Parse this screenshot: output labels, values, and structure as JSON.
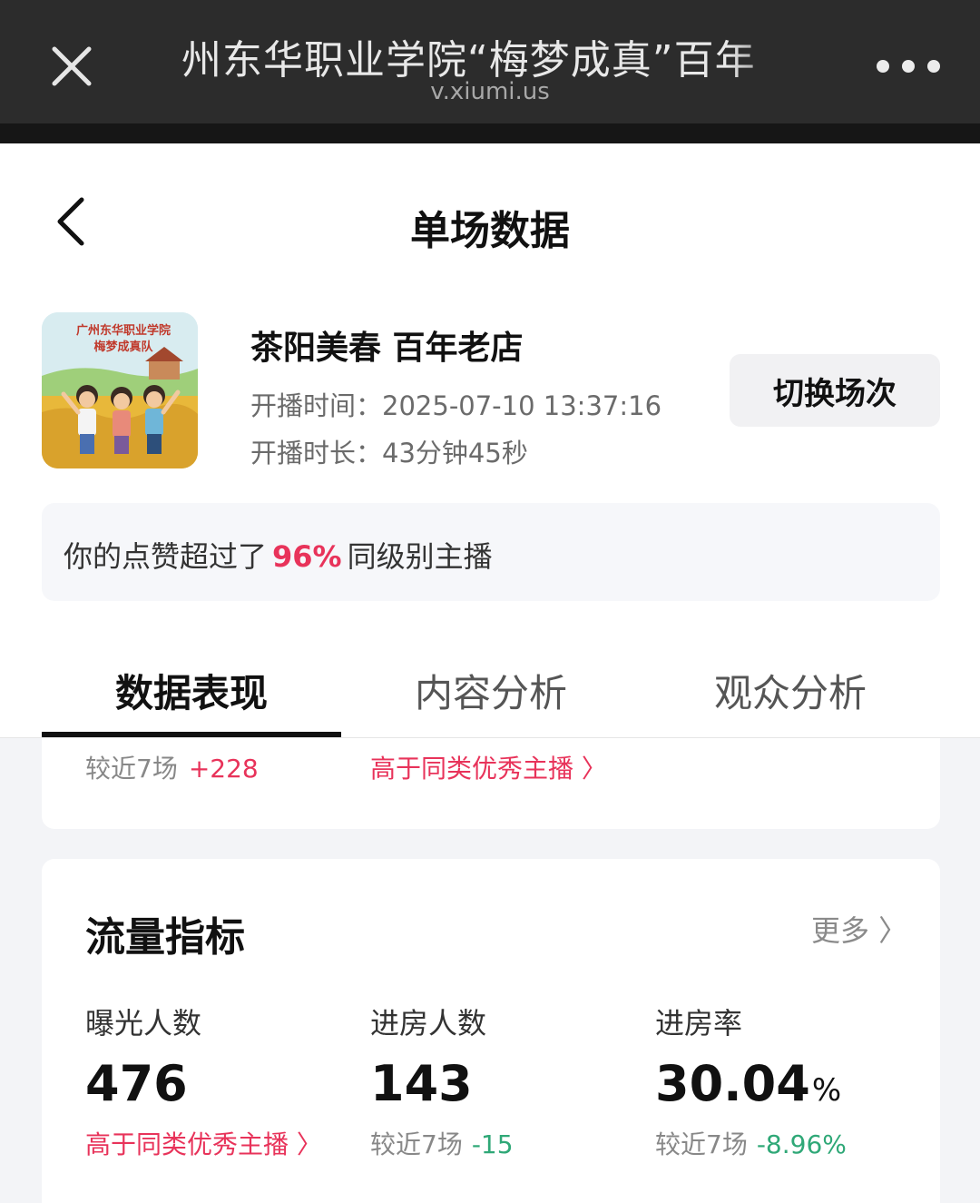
{
  "browser": {
    "title": "州东华职业学院“梅梦成真”百年",
    "url": "v.xiumi.us"
  },
  "page": {
    "title": "单场数据"
  },
  "stream": {
    "cover_text": "广州东华职业学院 梅梦成真队",
    "name": "茶阳美春 百年老店",
    "start_label": "开播时间：",
    "start_time": "2025-07-10 13:37:16",
    "duration_label": "开播时长：",
    "duration": "43分钟45秒",
    "switch_label": "切换场次"
  },
  "like_banner": {
    "prefix": "你的点赞超过了",
    "percent": "96%",
    "suffix": "同级别主播"
  },
  "tabs": [
    {
      "label": "数据表现",
      "active": true
    },
    {
      "label": "内容分析",
      "active": false
    },
    {
      "label": "观众分析",
      "active": false
    }
  ],
  "summary_row": {
    "compare_label": "较近7场",
    "compare_delta": "+228",
    "excellent_link": "高于同类优秀主播 〉"
  },
  "traffic": {
    "title": "流量指标",
    "more": "更多 〉",
    "metrics": [
      {
        "label": "曝光人数",
        "value": "476",
        "unit": "",
        "sub_link": "高于同类优秀主播 〉"
      },
      {
        "label": "进房人数",
        "value": "143",
        "unit": "",
        "sub_label": "较近7场",
        "sub_delta": "-15"
      },
      {
        "label": "进房率",
        "value": "30.04",
        "unit": "%",
        "sub_label": "较近7场",
        "sub_delta": "-8.96%"
      }
    ]
  },
  "colors": {
    "accent_pink": "#e8335a",
    "delta_green": "#2fa877",
    "topbar": "#2c2c2c"
  }
}
